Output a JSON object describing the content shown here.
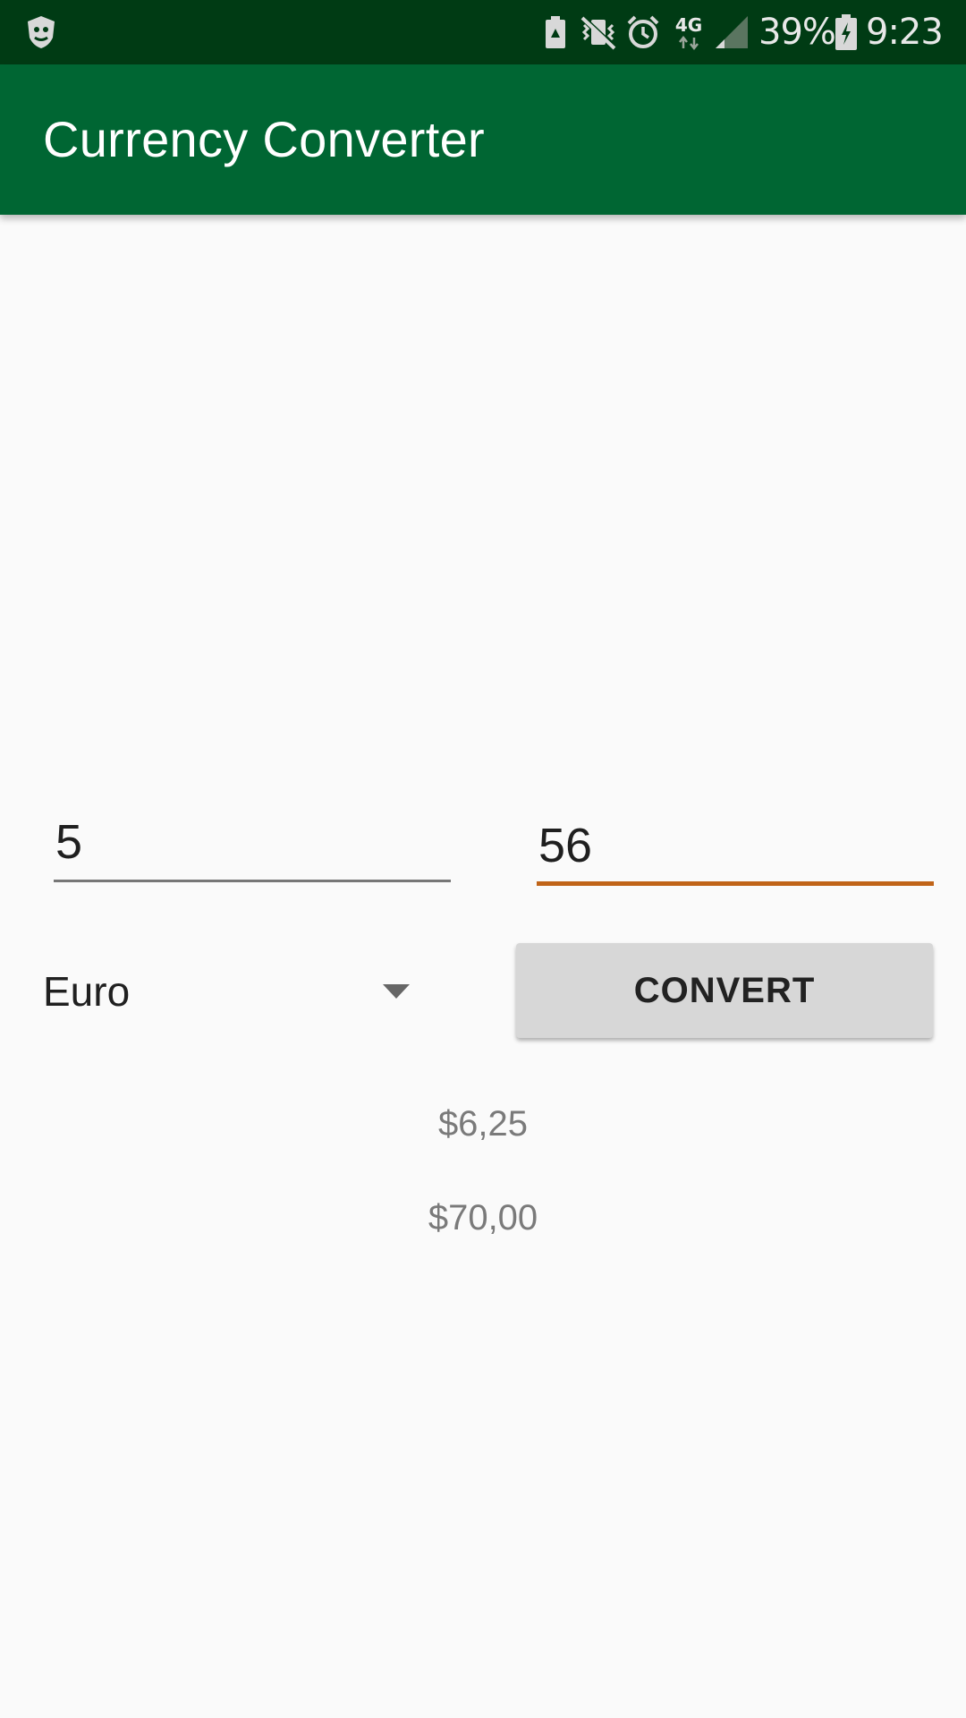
{
  "status_bar": {
    "network_type": "4G",
    "battery_percent": "39%",
    "time": "9:23",
    "icons": [
      "drweb-shield-icon",
      "battery-saver-icon",
      "vibrate-mute-icon",
      "alarm-icon",
      "data-arrows-icon",
      "signal-icon",
      "battery-charging-icon"
    ]
  },
  "app_bar": {
    "title": "Currency Converter",
    "color": "#006633"
  },
  "form": {
    "amount_value": "5",
    "rate_value": "56",
    "currency_selected": "Euro",
    "convert_label": "CONVERT",
    "focus_color": "#c06418"
  },
  "results": {
    "line1": "$6,25",
    "line2": "$70,00"
  }
}
